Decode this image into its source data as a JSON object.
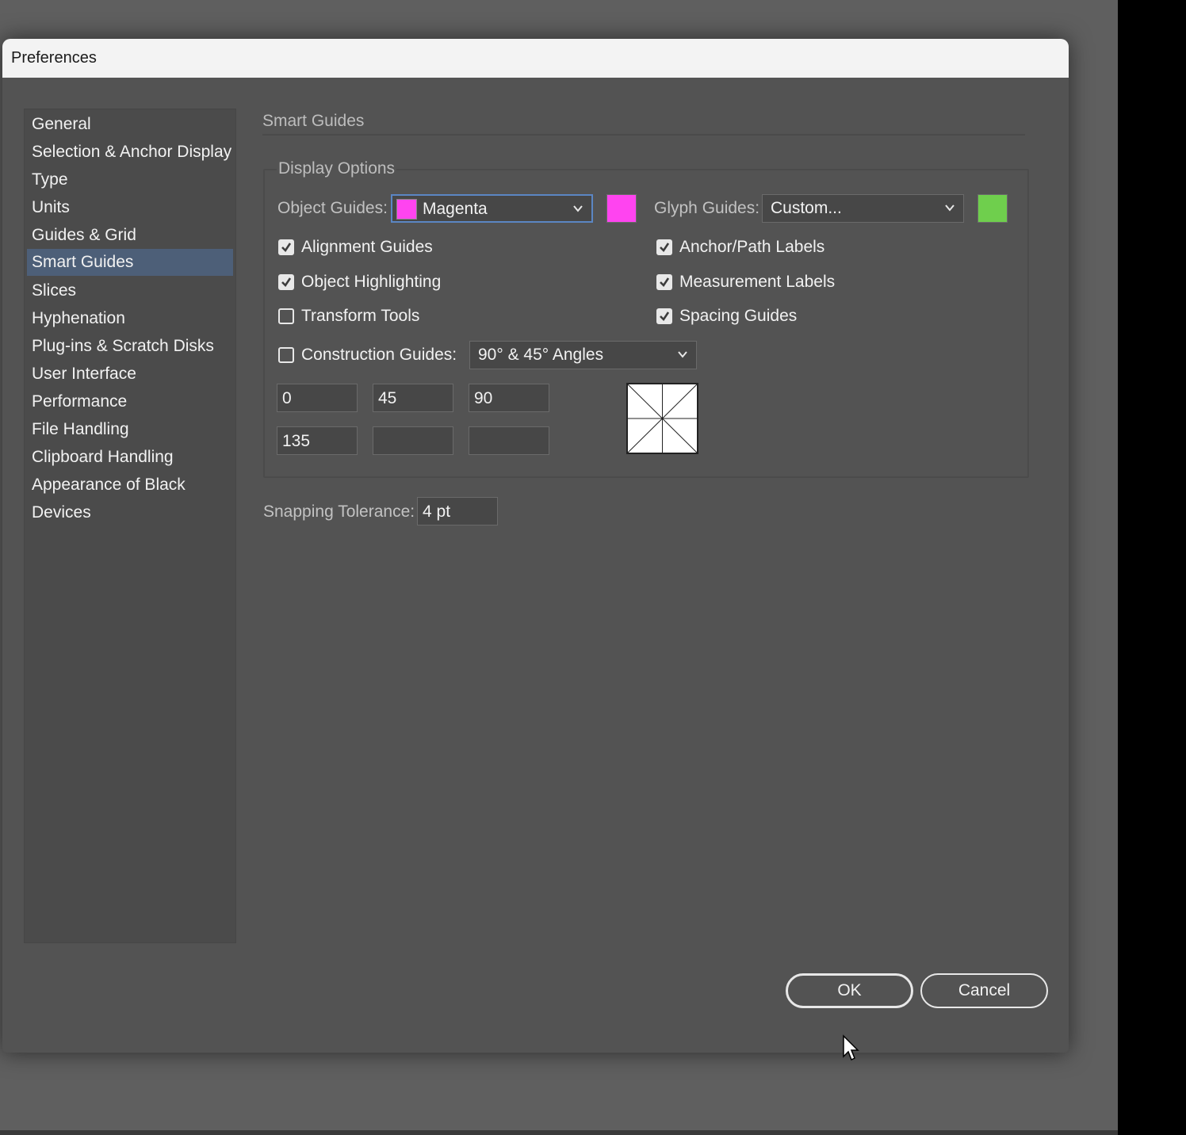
{
  "window": {
    "title": "Preferences"
  },
  "sidebar": {
    "items": [
      {
        "label": "General"
      },
      {
        "label": "Selection & Anchor Display"
      },
      {
        "label": "Type"
      },
      {
        "label": "Units"
      },
      {
        "label": "Guides & Grid"
      },
      {
        "label": "Smart Guides",
        "selected": true
      },
      {
        "label": "Slices"
      },
      {
        "label": "Hyphenation"
      },
      {
        "label": "Plug-ins & Scratch Disks"
      },
      {
        "label": "User Interface"
      },
      {
        "label": "Performance"
      },
      {
        "label": "File Handling"
      },
      {
        "label": "Clipboard Handling"
      },
      {
        "label": "Appearance of Black"
      },
      {
        "label": "Devices"
      }
    ]
  },
  "panel": {
    "title": "Smart Guides",
    "display_options": {
      "title": "Display Options",
      "object_guides": {
        "label": "Object Guides:",
        "value": "Magenta",
        "color": "#ff44f0"
      },
      "glyph_guides": {
        "label": "Glyph Guides:",
        "value": "Custom...",
        "color": "#6fcf4d"
      },
      "checkboxes": {
        "alignment_guides": {
          "label": "Alignment Guides",
          "checked": true
        },
        "object_highlighting": {
          "label": "Object Highlighting",
          "checked": true
        },
        "transform_tools": {
          "label": "Transform Tools",
          "checked": false
        },
        "anchor_path_labels": {
          "label": "Anchor/Path Labels",
          "checked": true
        },
        "measurement_labels": {
          "label": "Measurement Labels",
          "checked": true
        },
        "spacing_guides": {
          "label": "Spacing Guides",
          "checked": true
        }
      },
      "construction_guides": {
        "label": "Construction Guides:",
        "checked": false,
        "value": "90° & 45° Angles"
      },
      "angles": [
        "0",
        "45",
        "90",
        "135",
        "",
        ""
      ]
    },
    "snapping_tolerance": {
      "label": "Snapping Tolerance:",
      "value": "4 pt"
    }
  },
  "buttons": {
    "ok": "OK",
    "cancel": "Cancel"
  }
}
